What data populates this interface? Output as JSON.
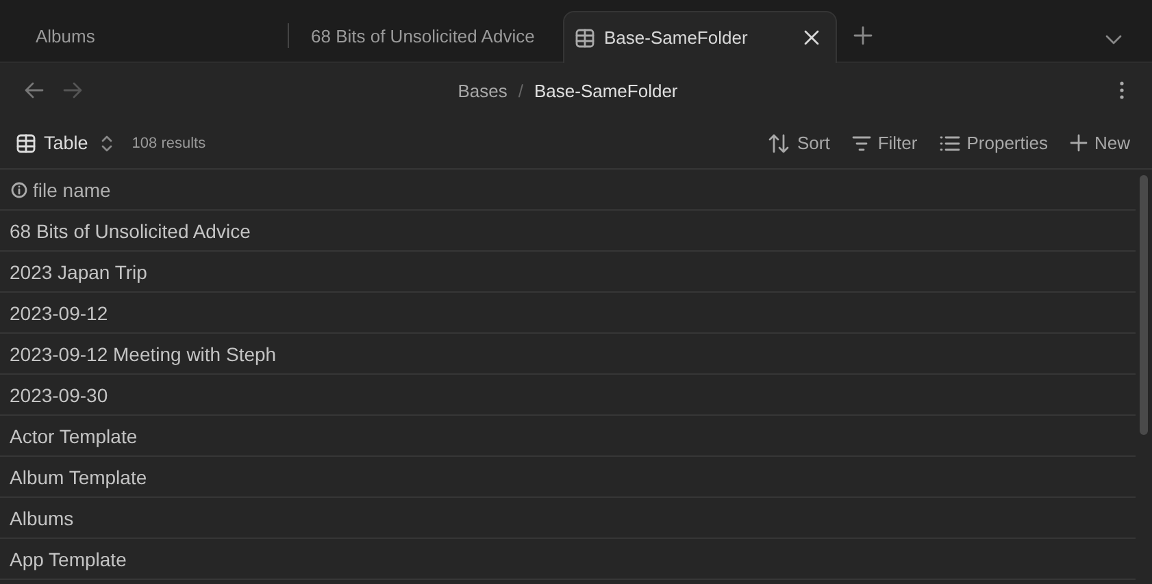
{
  "tabs": [
    {
      "label": "Albums",
      "selected": false
    },
    {
      "label": "68 Bits of Unsolicited Advice",
      "selected": false
    },
    {
      "label": "Base-SameFolder",
      "selected": true
    }
  ],
  "breadcrumb": {
    "parts": [
      "Bases",
      "Base-SameFolder"
    ],
    "separator": "/"
  },
  "toolbar": {
    "view": "Table",
    "count": "108 results",
    "actions": [
      {
        "kind": "sort",
        "label": "Sort"
      },
      {
        "kind": "filter",
        "label": "Filter"
      },
      {
        "kind": "properties",
        "label": "Properties"
      },
      {
        "kind": "new",
        "label": "New"
      }
    ]
  },
  "table": {
    "columns": [
      "file name"
    ],
    "rows": [
      "68 Bits of Unsolicited Advice",
      "2023 Japan Trip",
      "2023-09-12",
      "2023-09-12 Meeting with Steph",
      "2023-09-30",
      "Actor Template",
      "Album Template",
      "Albums",
      "App Template"
    ]
  }
}
